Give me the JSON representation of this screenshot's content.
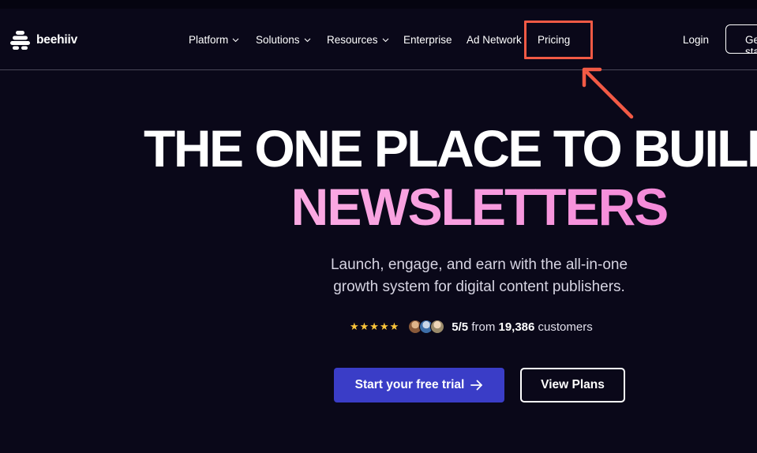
{
  "brand": {
    "name": "beehiiv"
  },
  "nav": {
    "items": [
      {
        "label": "Platform"
      },
      {
        "label": "Solutions"
      },
      {
        "label": "Resources"
      },
      {
        "label": "Enterprise"
      },
      {
        "label": "Ad Network"
      },
      {
        "label": "Pricing"
      }
    ],
    "login_label": "Login",
    "cta_label": "Get started",
    "highlighted_item": "Pricing"
  },
  "hero": {
    "headline_line1": "THE ONE PLACE TO BUILD",
    "headline_line2": "NEWSLETTERS",
    "subtext_line1": "Launch, engage, and earn with the all-in-one",
    "subtext_line2": "growth system for digital content publishers.",
    "rating": {
      "stars": "★★★★★",
      "score": "5/5",
      "from_text": "from",
      "count": "19,386",
      "suffix": "customers"
    },
    "primary_cta": "Start your free trial",
    "secondary_cta": "View Plans"
  },
  "colors": {
    "background": "#0a0819",
    "accent_button": "#3a3dc7",
    "headline_gradient_start": "#fbbde7",
    "headline_gradient_end": "#ef6ed0",
    "annotation": "#f25a45",
    "stars": "#fcc53a"
  },
  "icons": [
    "beehiiv-logo-icon",
    "chevron-down-icon",
    "arrow-right-icon",
    "annotation-arrow-icon"
  ]
}
